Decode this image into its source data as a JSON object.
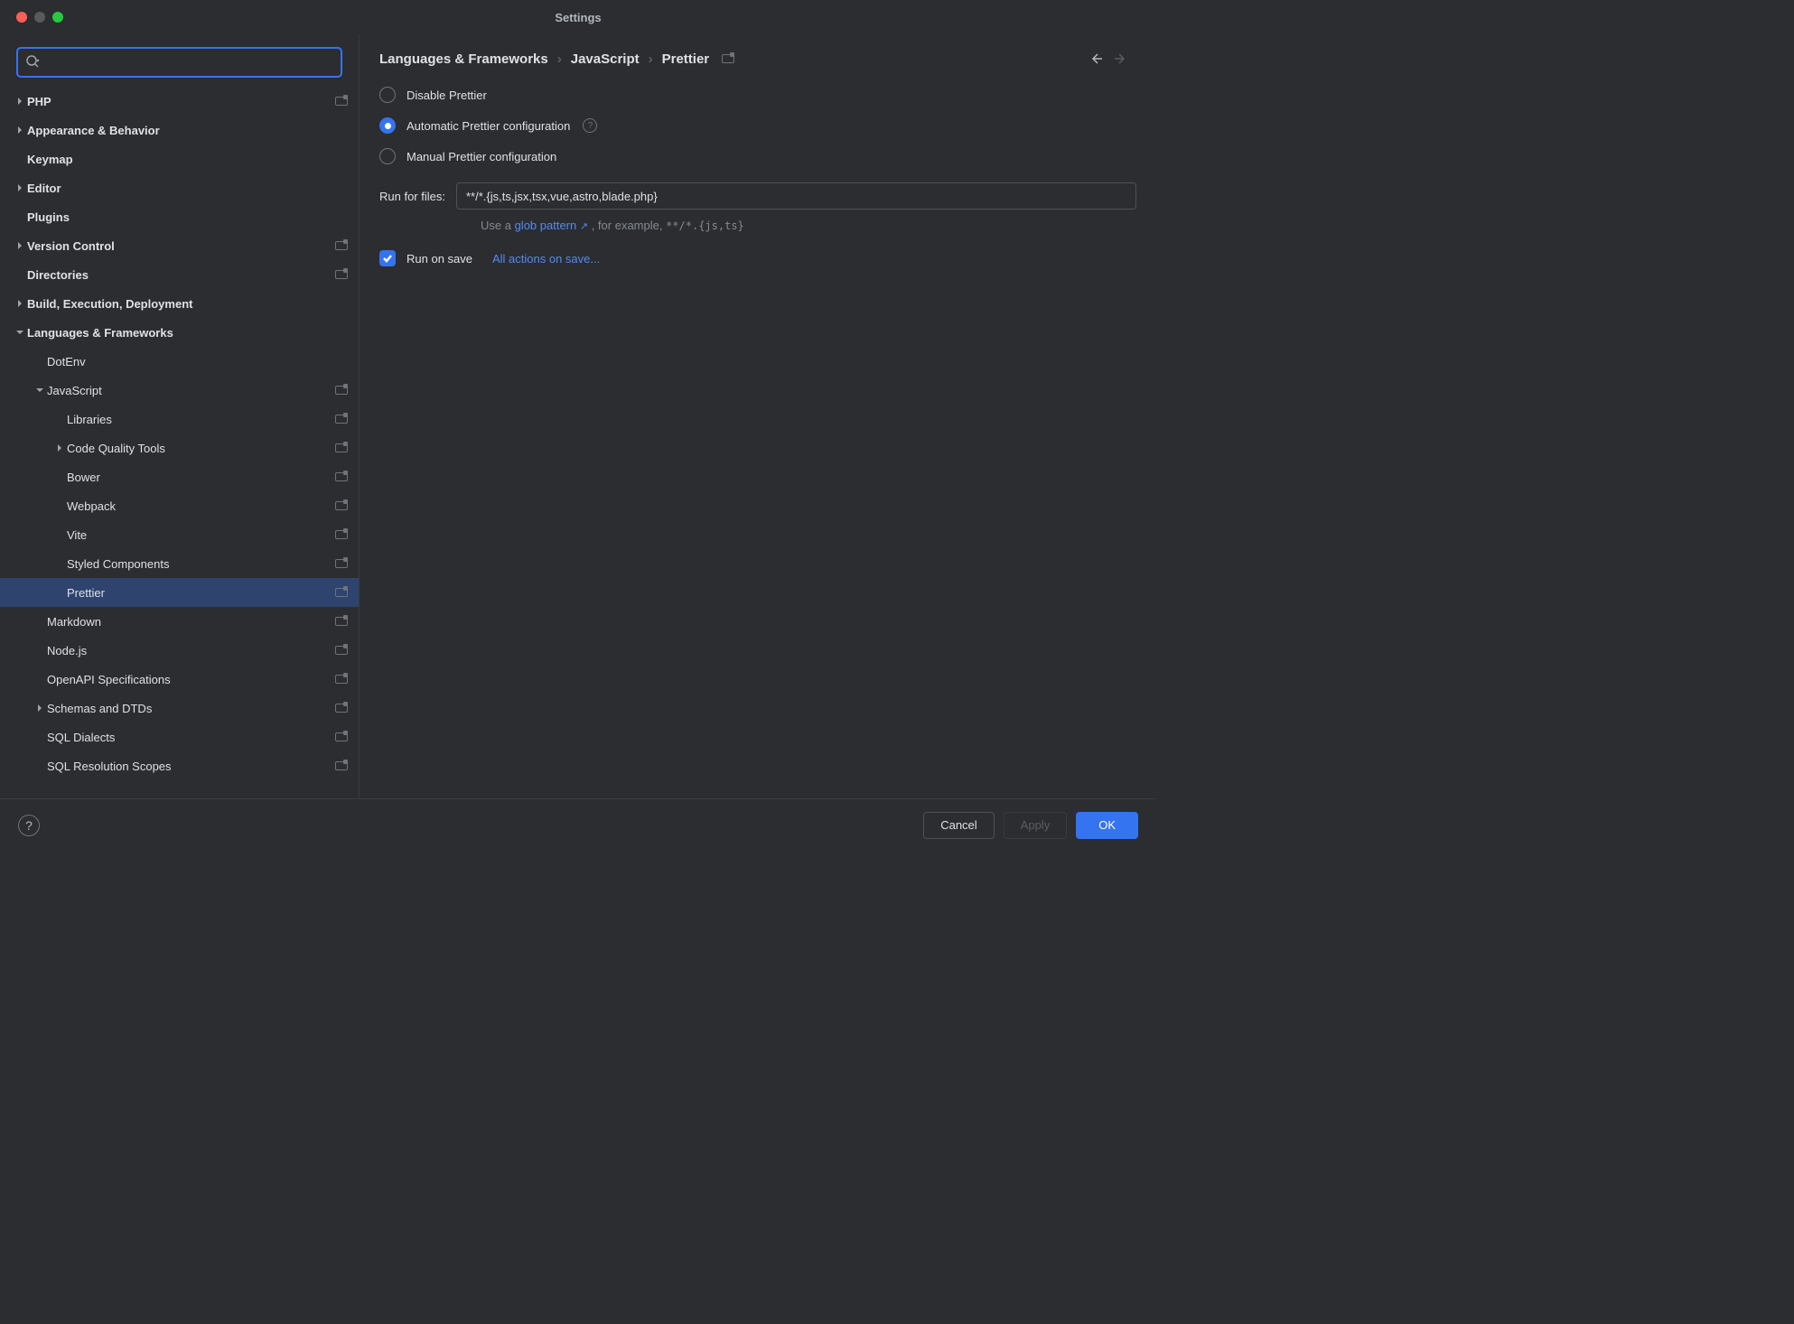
{
  "title": "Settings",
  "search": {
    "placeholder": ""
  },
  "tree": [
    {
      "label": "PHP",
      "bold": true,
      "depth": 0,
      "chevron": "right",
      "badge": true
    },
    {
      "label": "Appearance & Behavior",
      "bold": true,
      "depth": 0,
      "chevron": "right",
      "badge": false
    },
    {
      "label": "Keymap",
      "bold": true,
      "depth": 0,
      "chevron": "none",
      "badge": false
    },
    {
      "label": "Editor",
      "bold": true,
      "depth": 0,
      "chevron": "right",
      "badge": false
    },
    {
      "label": "Plugins",
      "bold": true,
      "depth": 0,
      "chevron": "none",
      "badge": false
    },
    {
      "label": "Version Control",
      "bold": true,
      "depth": 0,
      "chevron": "right",
      "badge": true
    },
    {
      "label": "Directories",
      "bold": true,
      "depth": 0,
      "chevron": "none",
      "badge": true
    },
    {
      "label": "Build, Execution, Deployment",
      "bold": true,
      "depth": 0,
      "chevron": "right",
      "badge": false
    },
    {
      "label": "Languages & Frameworks",
      "bold": true,
      "depth": 0,
      "chevron": "down",
      "badge": false
    },
    {
      "label": "DotEnv",
      "bold": false,
      "depth": 1,
      "chevron": "none",
      "badge": false
    },
    {
      "label": "JavaScript",
      "bold": false,
      "depth": 1,
      "chevron": "down",
      "badge": true
    },
    {
      "label": "Libraries",
      "bold": false,
      "depth": 2,
      "chevron": "none",
      "badge": true
    },
    {
      "label": "Code Quality Tools",
      "bold": false,
      "depth": 2,
      "chevron": "right",
      "badge": true
    },
    {
      "label": "Bower",
      "bold": false,
      "depth": 2,
      "chevron": "none",
      "badge": true
    },
    {
      "label": "Webpack",
      "bold": false,
      "depth": 2,
      "chevron": "none",
      "badge": true
    },
    {
      "label": "Vite",
      "bold": false,
      "depth": 2,
      "chevron": "none",
      "badge": true
    },
    {
      "label": "Styled Components",
      "bold": false,
      "depth": 2,
      "chevron": "none",
      "badge": true
    },
    {
      "label": "Prettier",
      "bold": false,
      "depth": 2,
      "chevron": "none",
      "badge": true,
      "selected": true
    },
    {
      "label": "Markdown",
      "bold": false,
      "depth": 1,
      "chevron": "none",
      "badge": true
    },
    {
      "label": "Node.js",
      "bold": false,
      "depth": 1,
      "chevron": "none",
      "badge": true
    },
    {
      "label": "OpenAPI Specifications",
      "bold": false,
      "depth": 1,
      "chevron": "none",
      "badge": true
    },
    {
      "label": "Schemas and DTDs",
      "bold": false,
      "depth": 1,
      "chevron": "right",
      "badge": true
    },
    {
      "label": "SQL Dialects",
      "bold": false,
      "depth": 1,
      "chevron": "none",
      "badge": true
    },
    {
      "label": "SQL Resolution Scopes",
      "bold": false,
      "depth": 1,
      "chevron": "none",
      "badge": true
    }
  ],
  "breadcrumb": [
    "Languages & Frameworks",
    "JavaScript",
    "Prettier"
  ],
  "radios": {
    "disable": "Disable Prettier",
    "automatic": "Automatic Prettier configuration",
    "manual": "Manual Prettier configuration",
    "selected": "automatic"
  },
  "runForFiles": {
    "label": "Run for files:",
    "value": "**/*.{js,ts,jsx,tsx,vue,astro,blade.php}"
  },
  "hint": {
    "prefix": "Use a ",
    "link": "glob pattern",
    "mid": " , for example, ",
    "example": "**/*.{js,ts}"
  },
  "runOnSave": {
    "label": "Run on save",
    "checked": true,
    "link": "All actions on save..."
  },
  "footer": {
    "cancel": "Cancel",
    "apply": "Apply",
    "ok": "OK"
  }
}
